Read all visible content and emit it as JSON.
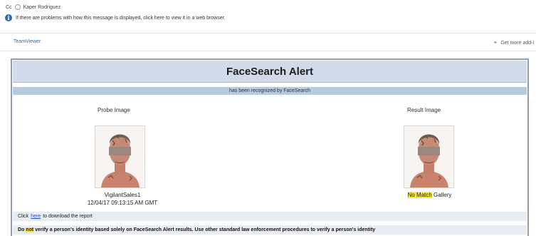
{
  "header": {
    "cc_label": "Cc",
    "cc_recipient": "Kaper Rodriguez",
    "info_text": "If there are problems with how this message is displayed, click here to view it in a web browser."
  },
  "addin_bar": {
    "teamviewer_label": "TeamViewer",
    "get_more_label": "Get more add-i"
  },
  "alert": {
    "title": "FaceSearch Alert",
    "subtitle": "has been recognized by FaceSearch",
    "probe_label": "Probe Image",
    "result_label": "Result Image",
    "probe_caption_line1": "VigilantSales1",
    "probe_caption_line2": "12/04/17 09:13:15 AM GMT",
    "result_no_match": "No Match",
    "result_gallery": " Gallery",
    "download_prefix": "Click",
    "download_link": "here",
    "download_suffix": "to download the report",
    "disclaimer_do": "Do",
    "disclaimer_not": "not",
    "disclaimer_rest": "verify a person's identity based solely on FaceSearch Alert results. Use other standard law enforcement procedures to verify a person's identity"
  },
  "colors": {
    "title_bg": "#cfdbea",
    "subtitle_bg": "#b7cadf",
    "highlight": "#f5e64a",
    "link": "#2b4fbf",
    "card_border": "#9a9ab2"
  }
}
